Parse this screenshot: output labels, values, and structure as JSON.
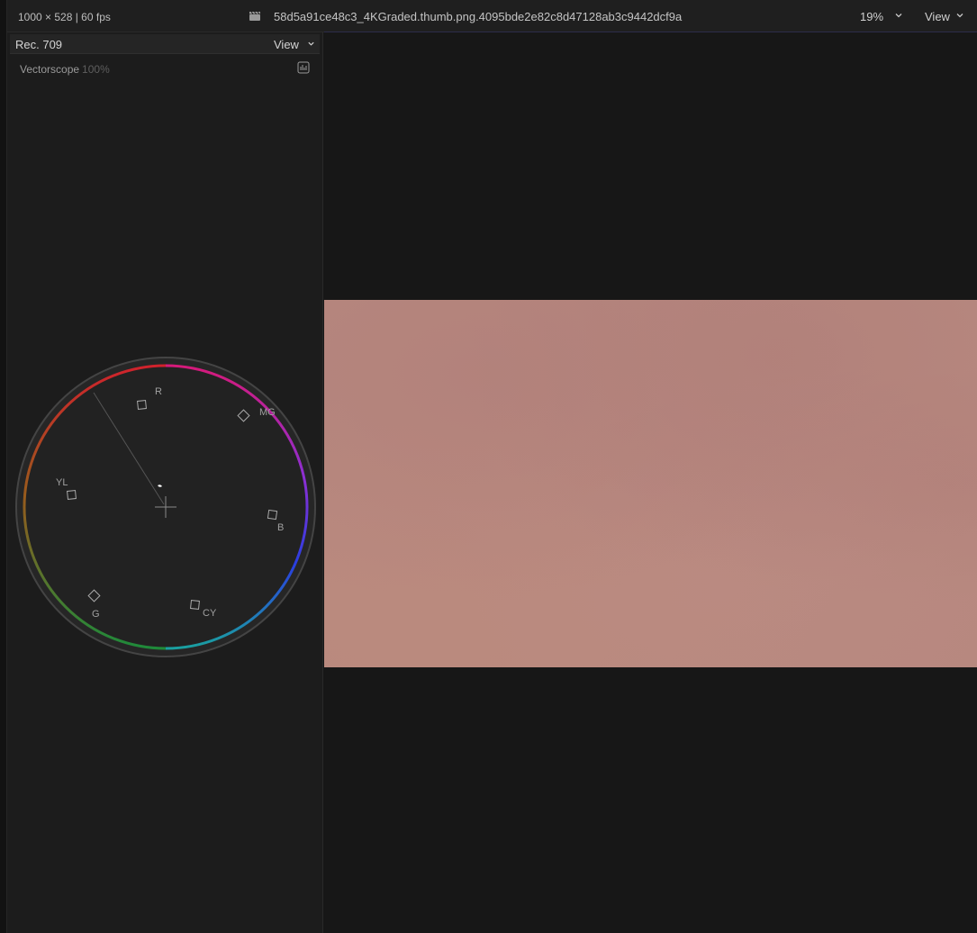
{
  "topbar": {
    "meta": "1000 × 528 | 60 fps",
    "clip_icon": "clapperboard-icon",
    "clip_name": "58d5a91ce48c3_4KGraded.thumb.png.4095bde2e82c8d47128ab3c9442dcf9a",
    "zoom": "19%",
    "view_label": "View"
  },
  "scopes": {
    "standard": "Rec. 709",
    "view_label": "View",
    "title": "Vectorscope",
    "scale": "100%",
    "settings_icon": "scope-settings-icon",
    "targets": [
      "R",
      "MG",
      "B",
      "CY",
      "G",
      "YL"
    ]
  },
  "colors": {
    "frame": "#b7887f",
    "background": "#171717",
    "panel": "#1c1c1c"
  }
}
